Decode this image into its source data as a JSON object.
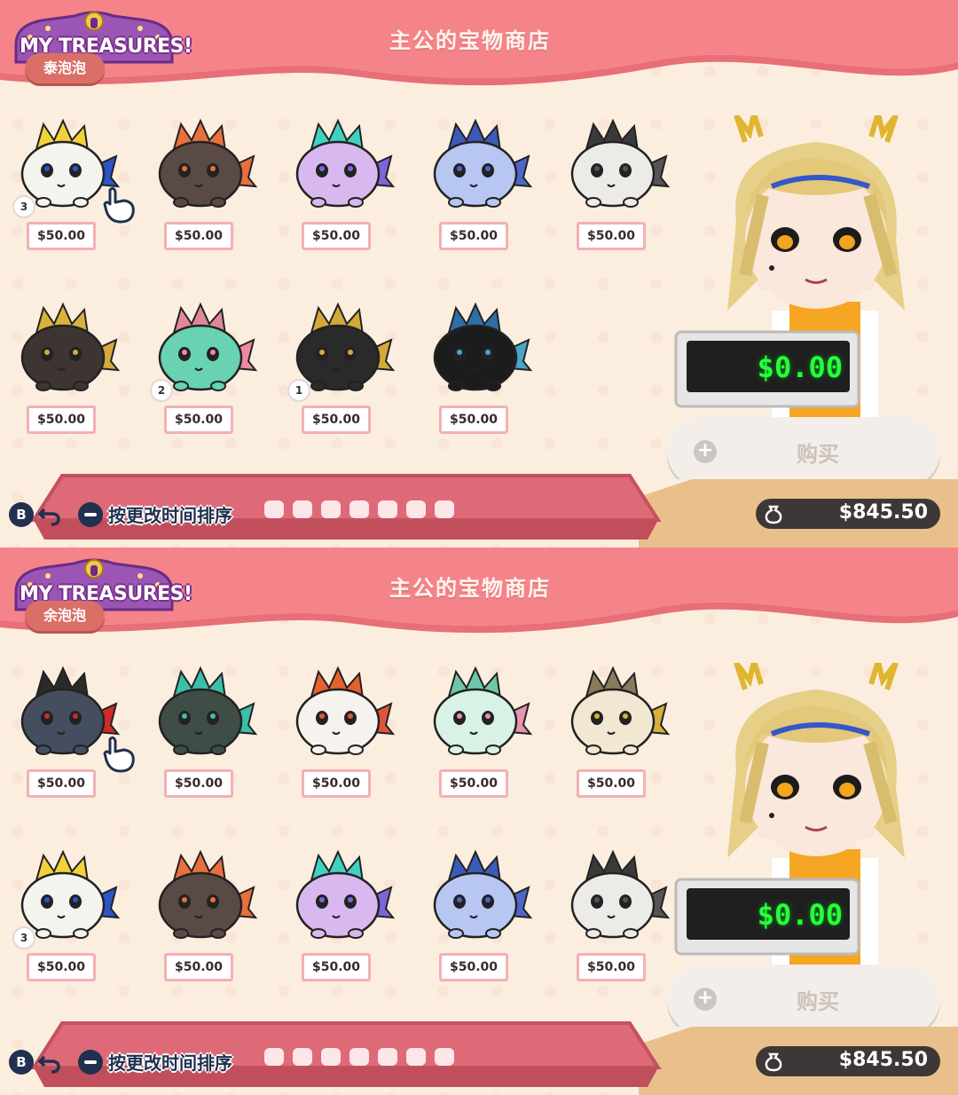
{
  "screens": [
    {
      "header_title": "主公的宝物商店",
      "logo_text": "MY TREASURES!",
      "owner_tab": "泰泡泡",
      "display_total": "$0.00",
      "buy_label": "购买",
      "buy_plus": "+",
      "balance": "$845.50",
      "controls": {
        "b_label": "B",
        "sort_label": "按更改时间排序"
      },
      "items": [
        {
          "price": "$50.00",
          "badge": "3",
          "color": "#f4f4ee",
          "accent": "#2c55c9",
          "crest": "#f2d23a"
        },
        {
          "price": "$50.00",
          "badge": "",
          "color": "#5a4a45",
          "accent": "#ea6f3c",
          "crest": "#e9703c"
        },
        {
          "price": "$50.00",
          "badge": "",
          "color": "#d9b8f0",
          "accent": "#7e66d8",
          "crest": "#3fd2c0"
        },
        {
          "price": "$50.00",
          "badge": "",
          "color": "#b7c7f2",
          "accent": "#4d67c9",
          "crest": "#3c5bb8"
        },
        {
          "price": "$50.00",
          "badge": "",
          "color": "#ecebe7",
          "accent": "#555555",
          "crest": "#3a3a3a"
        },
        {
          "price": "$50.00",
          "badge": "",
          "color": "#3d3531",
          "accent": "#d7a93b",
          "crest": "#d9b23c"
        },
        {
          "price": "$50.00",
          "badge": "2",
          "color": "#68d2b2",
          "accent": "#f08aa0",
          "crest": "#e0889a"
        },
        {
          "price": "$50.00",
          "badge": "1",
          "color": "#2a2a2a",
          "accent": "#d3a93a",
          "crest": "#d3a93a"
        },
        {
          "price": "$50.00",
          "badge": "",
          "color": "#1c1c1c",
          "accent": "#4aa6c8",
          "crest": "#2f6fa8"
        }
      ]
    },
    {
      "header_title": "主公的宝物商店",
      "logo_text": "MY TREASURES!",
      "owner_tab": "余泡泡",
      "display_total": "$0.00",
      "buy_label": "购买",
      "buy_plus": "+",
      "balance": "$845.50",
      "controls": {
        "b_label": "B",
        "sort_label": "按更改时间排序"
      },
      "items": [
        {
          "price": "$50.00",
          "badge": "",
          "color": "#454e5e",
          "accent": "#cf2b2b",
          "crest": "#2a2a2a"
        },
        {
          "price": "$50.00",
          "badge": "",
          "color": "#3f4d47",
          "accent": "#3bbfa8",
          "crest": "#3bbfa8"
        },
        {
          "price": "$50.00",
          "badge": "",
          "color": "#f6f2ee",
          "accent": "#e0553a",
          "crest": "#e7612f"
        },
        {
          "price": "$50.00",
          "badge": "",
          "color": "#d9f2e6",
          "accent": "#e892b4",
          "crest": "#6fc7a7"
        },
        {
          "price": "$50.00",
          "badge": "",
          "color": "#f1e7d2",
          "accent": "#d6b13d",
          "crest": "#8a7a5a"
        },
        {
          "price": "$50.00",
          "badge": "3",
          "color": "#f4f4ee",
          "accent": "#2c55c9",
          "crest": "#f2d23a"
        },
        {
          "price": "$50.00",
          "badge": "",
          "color": "#5a4a45",
          "accent": "#ea6f3c",
          "crest": "#e9703c"
        },
        {
          "price": "$50.00",
          "badge": "",
          "color": "#d9b8f0",
          "accent": "#7e66d8",
          "crest": "#3fd2c0"
        },
        {
          "price": "$50.00",
          "badge": "",
          "color": "#b7c7f2",
          "accent": "#4d67c9",
          "crest": "#3c5bb8"
        },
        {
          "price": "$50.00",
          "badge": "",
          "color": "#ecebe7",
          "accent": "#555555",
          "crest": "#3a3a3a"
        }
      ]
    }
  ]
}
